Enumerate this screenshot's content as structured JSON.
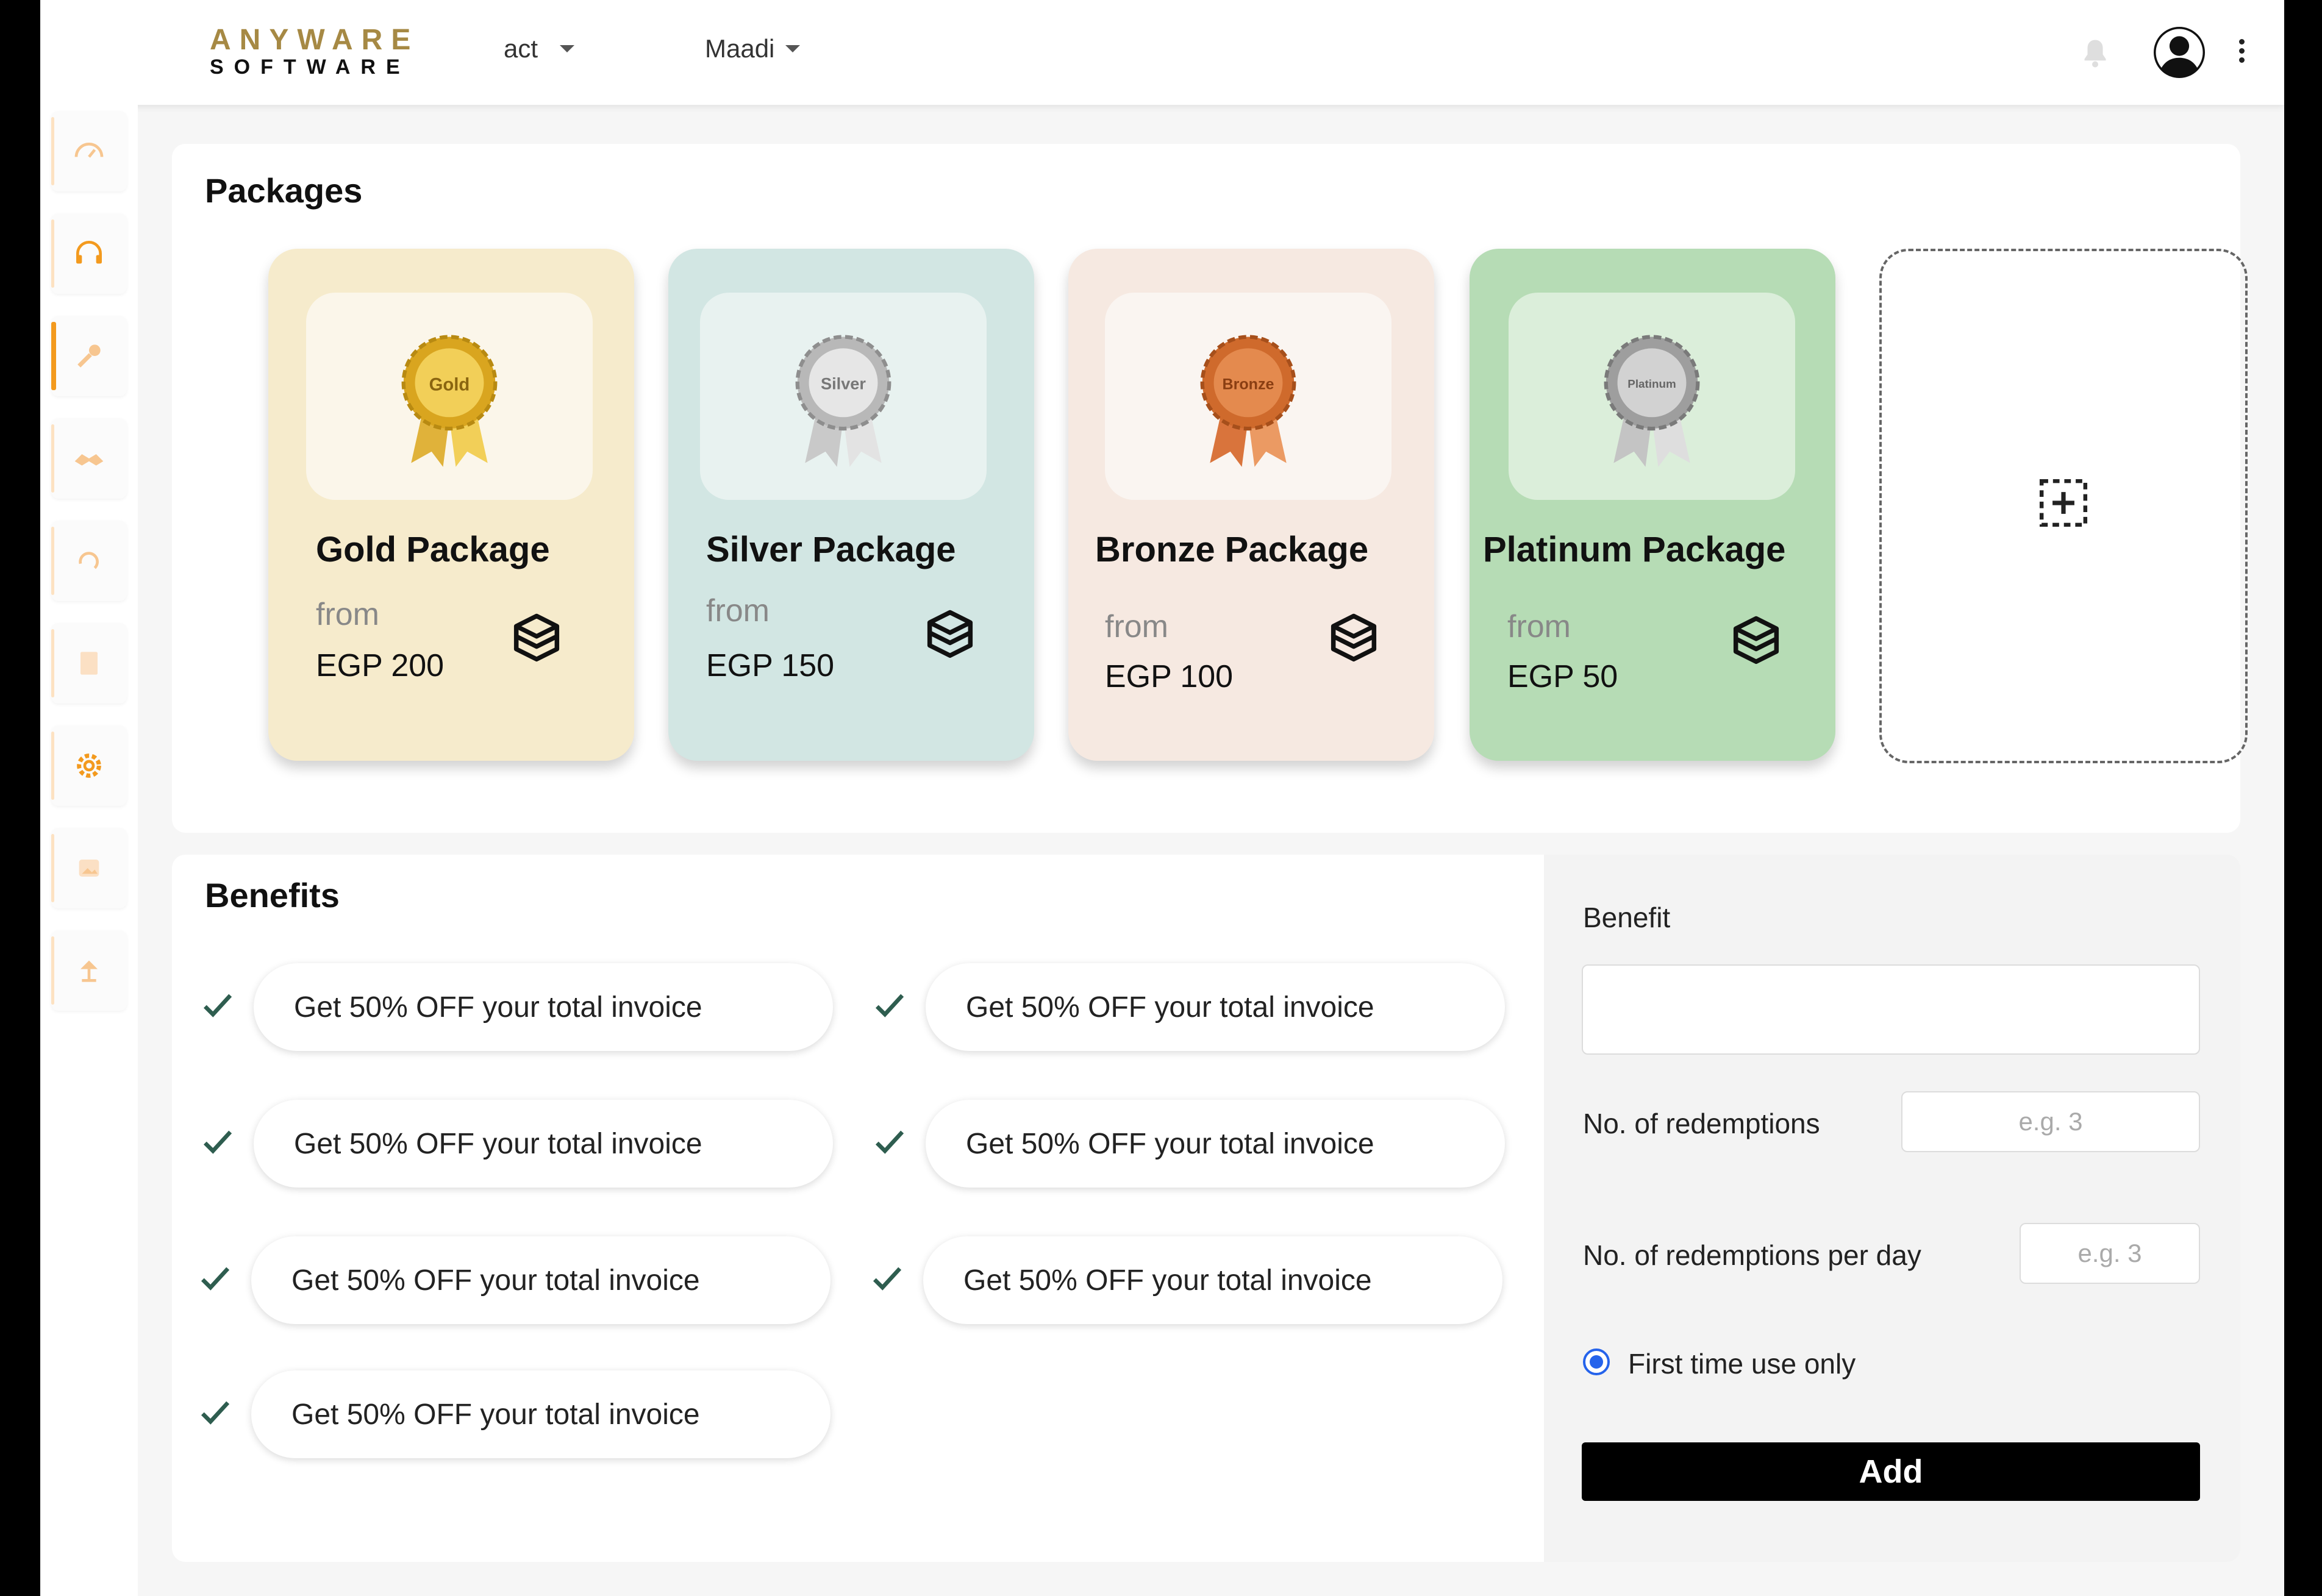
{
  "header": {
    "logo_top": "ANYWARE",
    "logo_bottom": "SOFTWARE",
    "select_1": "act",
    "select_2": "Maadi",
    "icons": [
      "bell-icon",
      "avatar-icon",
      "kebab-menu-icon"
    ]
  },
  "sidebar": {
    "items": [
      {
        "icon": "dashboard-gauge-icon",
        "active": false
      },
      {
        "icon": "headset-icon",
        "active": false
      },
      {
        "icon": "tools-icon",
        "active": true
      },
      {
        "icon": "handshake-icon",
        "active": false
      },
      {
        "icon": "refresh-icon",
        "active": false
      },
      {
        "icon": "document-icon",
        "active": false
      },
      {
        "icon": "settings-gear-icon",
        "active": false
      },
      {
        "icon": "image-icon",
        "active": false
      },
      {
        "icon": "lamp-icon",
        "active": false
      }
    ],
    "accent_color": "#f39a1e"
  },
  "packages": {
    "title": "Packages",
    "items": [
      {
        "name": "Gold Package",
        "from": "from",
        "price": "EGP 200",
        "medal_label": "Gold",
        "bg": "#f6ebcc"
      },
      {
        "name": "Silver Package",
        "from": "from",
        "price": "EGP 150",
        "medal_label": "Silver",
        "bg": "#d2e6e3"
      },
      {
        "name": "Bronze Package",
        "from": "from",
        "price": "EGP 100",
        "medal_label": "Bronze",
        "bg": "#f6e9e1"
      },
      {
        "name": "Platinum Package",
        "from": "from",
        "price": "EGP 50",
        "medal_label": "Platinum",
        "bg": "#b6dcb5"
      }
    ],
    "add_icon": "add-package-icon"
  },
  "benefits": {
    "title": "Benefits",
    "items": [
      "Get 50% OFF your total invoice",
      "Get 50% OFF your total invoice",
      "Get 50% OFF your total invoice",
      "Get 50% OFF your total invoice",
      "Get 50% OFF your total invoice",
      "Get 50% OFF your total invoice",
      "Get 50% OFF your total invoice"
    ]
  },
  "form": {
    "benefit_label": "Benefit",
    "benefit_value": "",
    "redemptions_label": "No. of redemptions",
    "redemptions_placeholder": "e.g. 3",
    "redemptions_per_day_label": "No. of redemptions per day",
    "redemptions_per_day_placeholder": "e.g. 3",
    "first_time_label": "First time use only",
    "first_time_checked": true,
    "add_button": "Add"
  }
}
